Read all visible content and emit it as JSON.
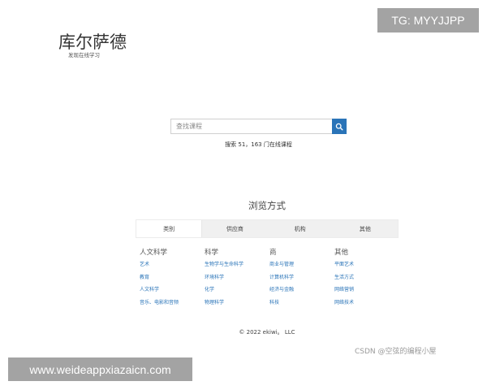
{
  "logo": {
    "title": "库尔萨德",
    "subtitle": "发现在线学习"
  },
  "watermark_tg": "TG: MYYJJPP",
  "search": {
    "placeholder": "查找课程",
    "count_text": "搜索 51，163 门在线课程",
    "icon": "search-icon"
  },
  "browse": {
    "title": "浏览方式",
    "tabs": [
      {
        "label": "类别",
        "active": true
      },
      {
        "label": "供应商",
        "active": false
      },
      {
        "label": "机构",
        "active": false
      },
      {
        "label": "其他",
        "active": false
      }
    ]
  },
  "categories": [
    {
      "heading": "人文科学",
      "links": [
        "艺术",
        "教育",
        "人文科学",
        "音乐、电影和音频"
      ]
    },
    {
      "heading": "科学",
      "links": [
        "生物学与生命科学",
        "环境科学",
        "化学",
        "物理科学"
      ]
    },
    {
      "heading": "商",
      "links": [
        "商业与管理",
        "计算机科学",
        "经济与金融",
        "科技"
      ]
    },
    {
      "heading": "其他",
      "links": [
        "平面艺术",
        "生活方式",
        "网络营销",
        "网络技术"
      ]
    }
  ],
  "footer": "© 2022 ekiwi。 LLC",
  "watermark_csdn": "CSDN @空弦的编程小屋",
  "watermark_url": "www.weideappxiazaicn.com",
  "colors": {
    "accent": "#2a74b8",
    "badge_bg": "#a3a3a3"
  }
}
